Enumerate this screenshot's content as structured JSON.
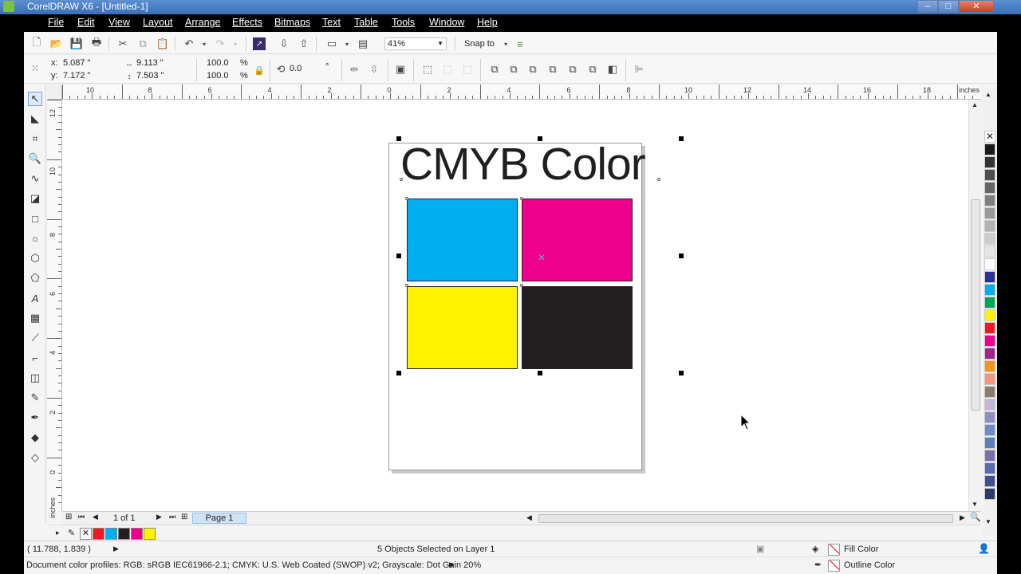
{
  "window": {
    "title": "CorelDRAW X6 - [Untitled-1]",
    "min": "–",
    "max": "□",
    "close": "✕"
  },
  "menu": [
    "File",
    "Edit",
    "View",
    "Layout",
    "Arrange",
    "Effects",
    "Bitmaps",
    "Text",
    "Table",
    "Tools",
    "Window",
    "Help"
  ],
  "standard_toolbar": {
    "zoom_value": "41%",
    "snap_to_label": "Snap to"
  },
  "property_bar": {
    "x_label": "x:",
    "x_value": "5.087 \"",
    "y_label": "y:",
    "y_value": "7.172 \"",
    "width_value": "9.113 \"",
    "height_value": "7.503 \"",
    "scale_w": "100.0",
    "scale_h": "100.0",
    "pct": "%",
    "rotation": "0.0",
    "deg": "°"
  },
  "ruler": {
    "units": "inches",
    "h_labels": [
      "10",
      "8",
      "6",
      "4",
      "2",
      "0",
      "2",
      "4",
      "6",
      "8",
      "10",
      "12",
      "14",
      "16",
      "18"
    ],
    "v_labels": [
      "12",
      "10",
      "8",
      "6",
      "4",
      "2",
      "0"
    ]
  },
  "canvas": {
    "heading": "CMYB Color",
    "swatch_colors": {
      "cyan": "#00aeef",
      "magenta": "#ec008c",
      "yellow": "#fff200",
      "black": "#231f20"
    }
  },
  "palette_colors": [
    "#1a1a1a",
    "#333333",
    "#4d4d4d",
    "#666666",
    "#808080",
    "#999999",
    "#b3b3b3",
    "#cccccc",
    "#e6e6e6",
    "#ffffff",
    "#2e3192",
    "#00aeef",
    "#00a651",
    "#fff200",
    "#ed1c24",
    "#ec008c",
    "#a3238e",
    "#f7941d",
    "#f69679",
    "#8b7d6b",
    "#c1b6d9",
    "#8f8fc8",
    "#6d8ccc",
    "#5d7fb8",
    "#7b6fb0",
    "#5b6ca8",
    "#44508c",
    "#2c3a6e"
  ],
  "page_nav": {
    "page_count": "1 of 1",
    "tab": "Page 1"
  },
  "document_palette": [
    "#ed1c24",
    "#00aeef",
    "#231f20",
    "#ec008c",
    "#fff200"
  ],
  "status": {
    "coords": "( 11.788, 1.839 )",
    "selection": "5 Objects Selected on Layer 1",
    "fill_label": "Fill Color",
    "outline_label": "Outline Color",
    "profiles": "Document color profiles: RGB: sRGB IEC61966-2.1; CMYK: U.S. Web Coated (SWOP) v2; Grayscale: Dot Gain 20%"
  },
  "icons": [
    "app-logo-icon",
    "new-icon",
    "open-icon",
    "save-icon",
    "print-icon",
    "cut-icon",
    "copy-icon",
    "paste-icon",
    "undo-icon",
    "redo-icon",
    "search-icon",
    "import-icon",
    "export-icon",
    "publish-icon",
    "view-icon",
    "snap-icon",
    "pick-tool-icon",
    "shape-tool-icon",
    "crop-tool-icon",
    "zoom-tool-icon",
    "freehand-tool-icon",
    "smart-fill-icon",
    "rectangle-tool-icon",
    "ellipse-tool-icon",
    "polygon-tool-icon",
    "basic-shapes-icon",
    "text-tool-icon",
    "table-tool-icon",
    "dimension-tool-icon",
    "connector-tool-icon",
    "blend-tool-icon",
    "eyedropper-tool-icon",
    "outline-pen-icon",
    "fill-tool-icon",
    "interactive-fill-icon",
    "mouse-cursor-icon"
  ]
}
